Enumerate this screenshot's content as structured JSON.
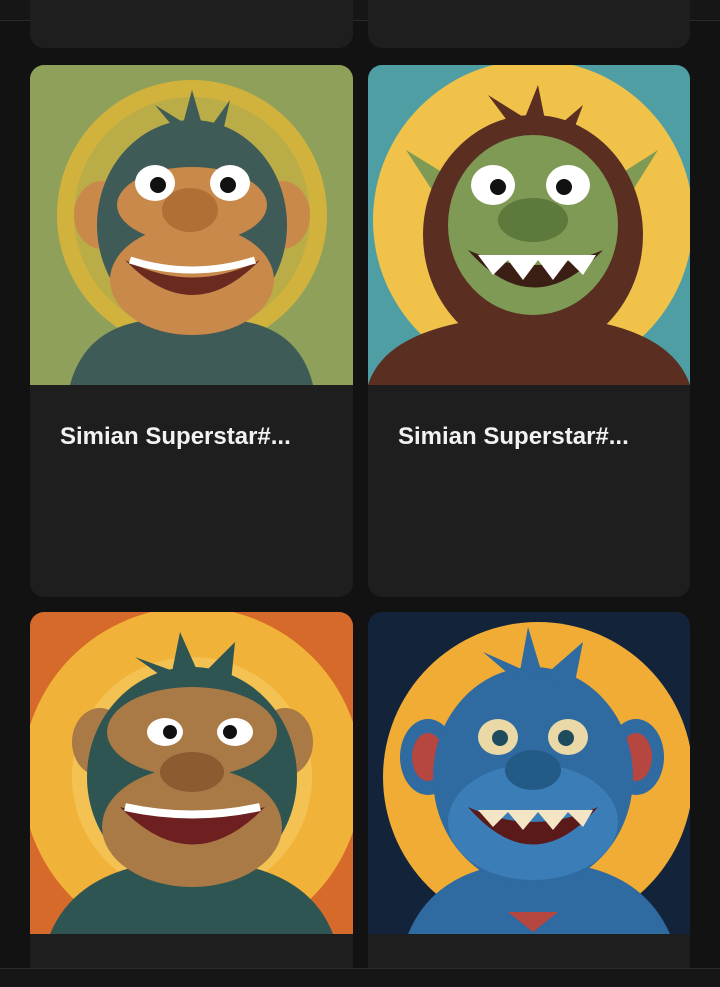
{
  "cards": [
    {
      "title": "",
      "theme": {
        "bg": "#1e1e1e"
      }
    },
    {
      "title": "",
      "theme": {
        "bg": "#1e1e1e"
      }
    },
    {
      "title": "Simian Superstar#...",
      "theme": {
        "bg": "#8fa05a",
        "halo": "#d8b43a",
        "fur": "#3f5b57",
        "face": "#c9894a",
        "icon": "green-ape-portrait"
      }
    },
    {
      "title": "Simian Superstar#...",
      "theme": {
        "bg": "#4f9ea3",
        "halo": "#f0c24a",
        "fur": "#5a2f22",
        "face": "#7f9a55",
        "icon": "ogre-ape-portrait"
      }
    },
    {
      "title": "",
      "theme": {
        "bg": "#d66a2b",
        "halo": "#f1b23a",
        "fur": "#2f5552",
        "face": "#a97a45",
        "icon": "angry-ape-portrait"
      }
    },
    {
      "title": "",
      "theme": {
        "bg": "#13233a",
        "halo": "#f0ac35",
        "fur": "#2f6aa0",
        "face": "#3a7db7",
        "icon": "blue-ape-portrait"
      }
    }
  ]
}
